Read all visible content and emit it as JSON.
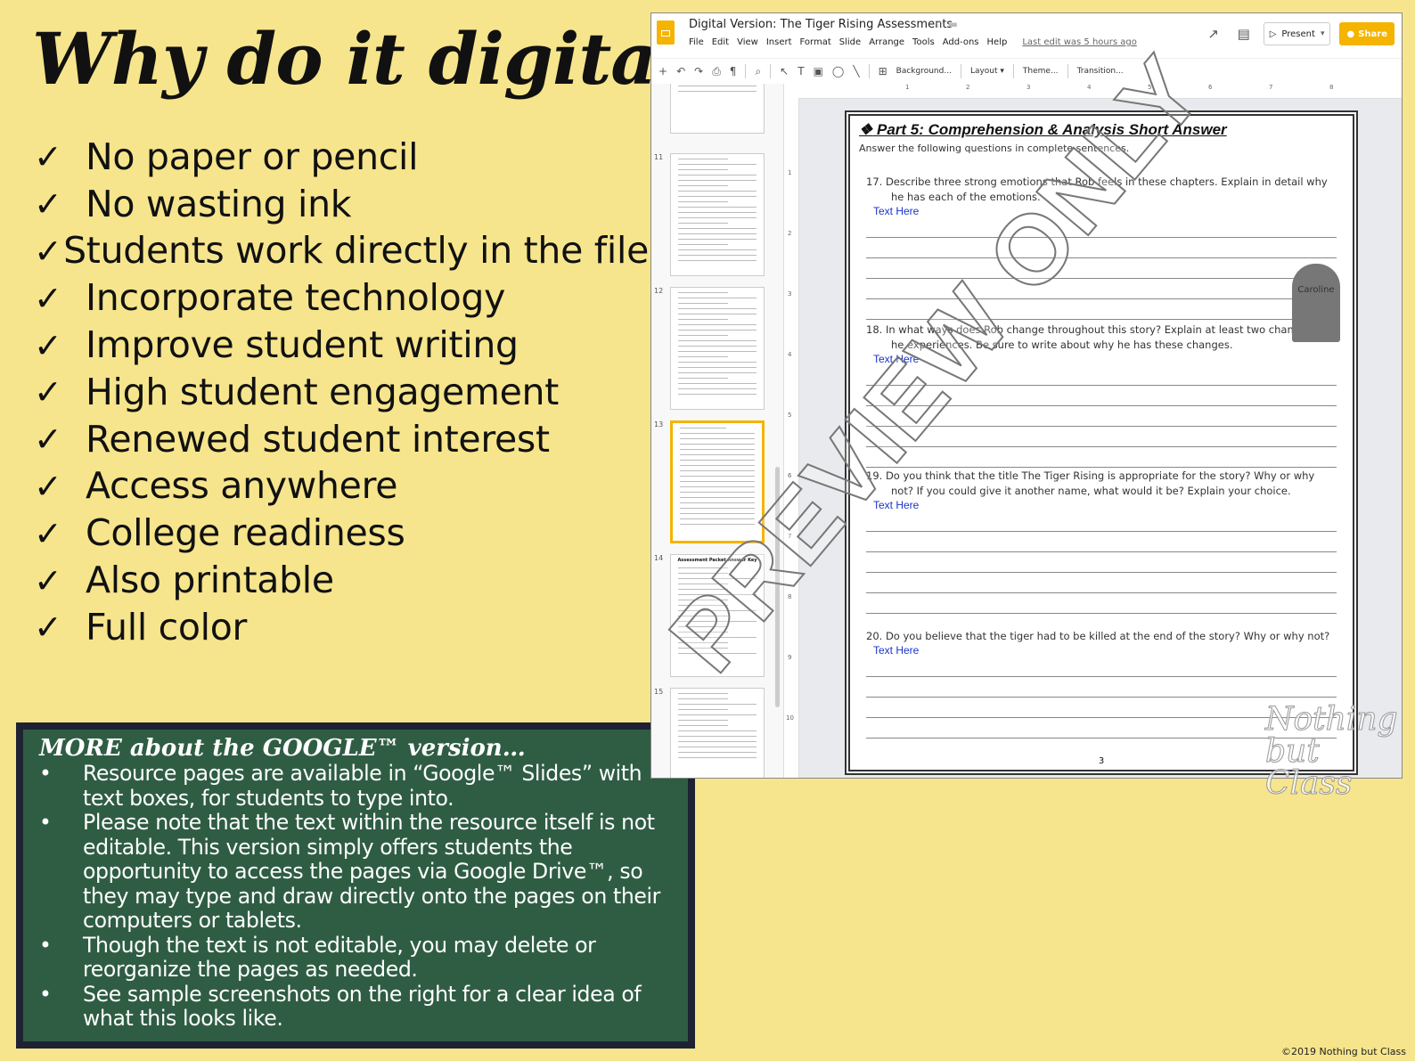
{
  "headline": "Why do it digital?",
  "checklist": [
    "No paper or pencil",
    "No wasting ink",
    "Students work directly in the file",
    "Incorporate technology",
    "Improve student writing",
    "High student engagement",
    "Renewed student interest",
    "Access anywhere",
    "College readiness",
    "Also printable",
    "Full color"
  ],
  "check_symbol": "✓",
  "info": {
    "title": "MORE about the GOOGLE™ version…",
    "bullet": "•",
    "items": [
      "Resource pages are available in “Google™ Slides” with text boxes, for students to type into.",
      "Please note that the text within the resource itself is not editable. This version simply offers students the opportunity to access the pages via Google Drive™, so they may type and draw directly onto the pages on their computers or tablets.",
      "Though the text is not editable, you may delete or reorganize the pages as needed.",
      "See sample screenshots on the right for a clear idea of what this looks like."
    ],
    "colors": {
      "border": "#1e2233",
      "background": "#2f5d43"
    }
  },
  "copyright": "©2019 Nothing but Class",
  "window": {
    "title": "Digital Version: The Tiger Rising Assessments",
    "menu": [
      "File",
      "Edit",
      "View",
      "Insert",
      "Format",
      "Slide",
      "Arrange",
      "Tools",
      "Add-ons",
      "Help"
    ],
    "last_edit": "Last edit was 5 hours ago",
    "present_label": "Present",
    "share_label": "Share",
    "accent": "#f4b400",
    "toolbar_text": [
      "Background...",
      "Layout ▾",
      "Theme...",
      "Transition..."
    ],
    "slide_numbers": [
      "11",
      "12",
      "13",
      "14",
      "15"
    ],
    "ruler_top": [
      "1",
      "2",
      "3",
      "4",
      "5",
      "6",
      "7",
      "8"
    ],
    "ruler_left": [
      "1",
      "2",
      "3",
      "4",
      "5",
      "6",
      "7",
      "8",
      "9",
      "10"
    ],
    "thumb_14_title": "Assessment Packet Answer Key"
  },
  "page": {
    "title_symbol": "❖",
    "title": "Part 5: Comprehension & Analysis Short Answer",
    "intro": "Answer the following questions in complete sentences.",
    "answer_label": "Text Here",
    "questions": [
      {
        "num": "17.",
        "text": "Describe three strong emotions that Rob feels in these chapters. Explain in detail why he has each of the emotions."
      },
      {
        "num": "18.",
        "text": "In what ways does Rob change throughout this story? Explain at least two changes that he experiences. Be sure to write about why he has these changes."
      },
      {
        "num": "19.",
        "text": "Do you think that the title The Tiger Rising is appropriate for the story? Why or why not? If you could give it another name, what would it be? Explain your choice."
      },
      {
        "num": "20.",
        "text": "Do you believe that the tiger had to be killed at the end of the story? Why or why not?"
      }
    ],
    "page_number": "3",
    "tombstone_text": "Caroline"
  },
  "watermark": "PREVIEW ONLY",
  "brand_mark": "Nothing\nbut\nClass"
}
